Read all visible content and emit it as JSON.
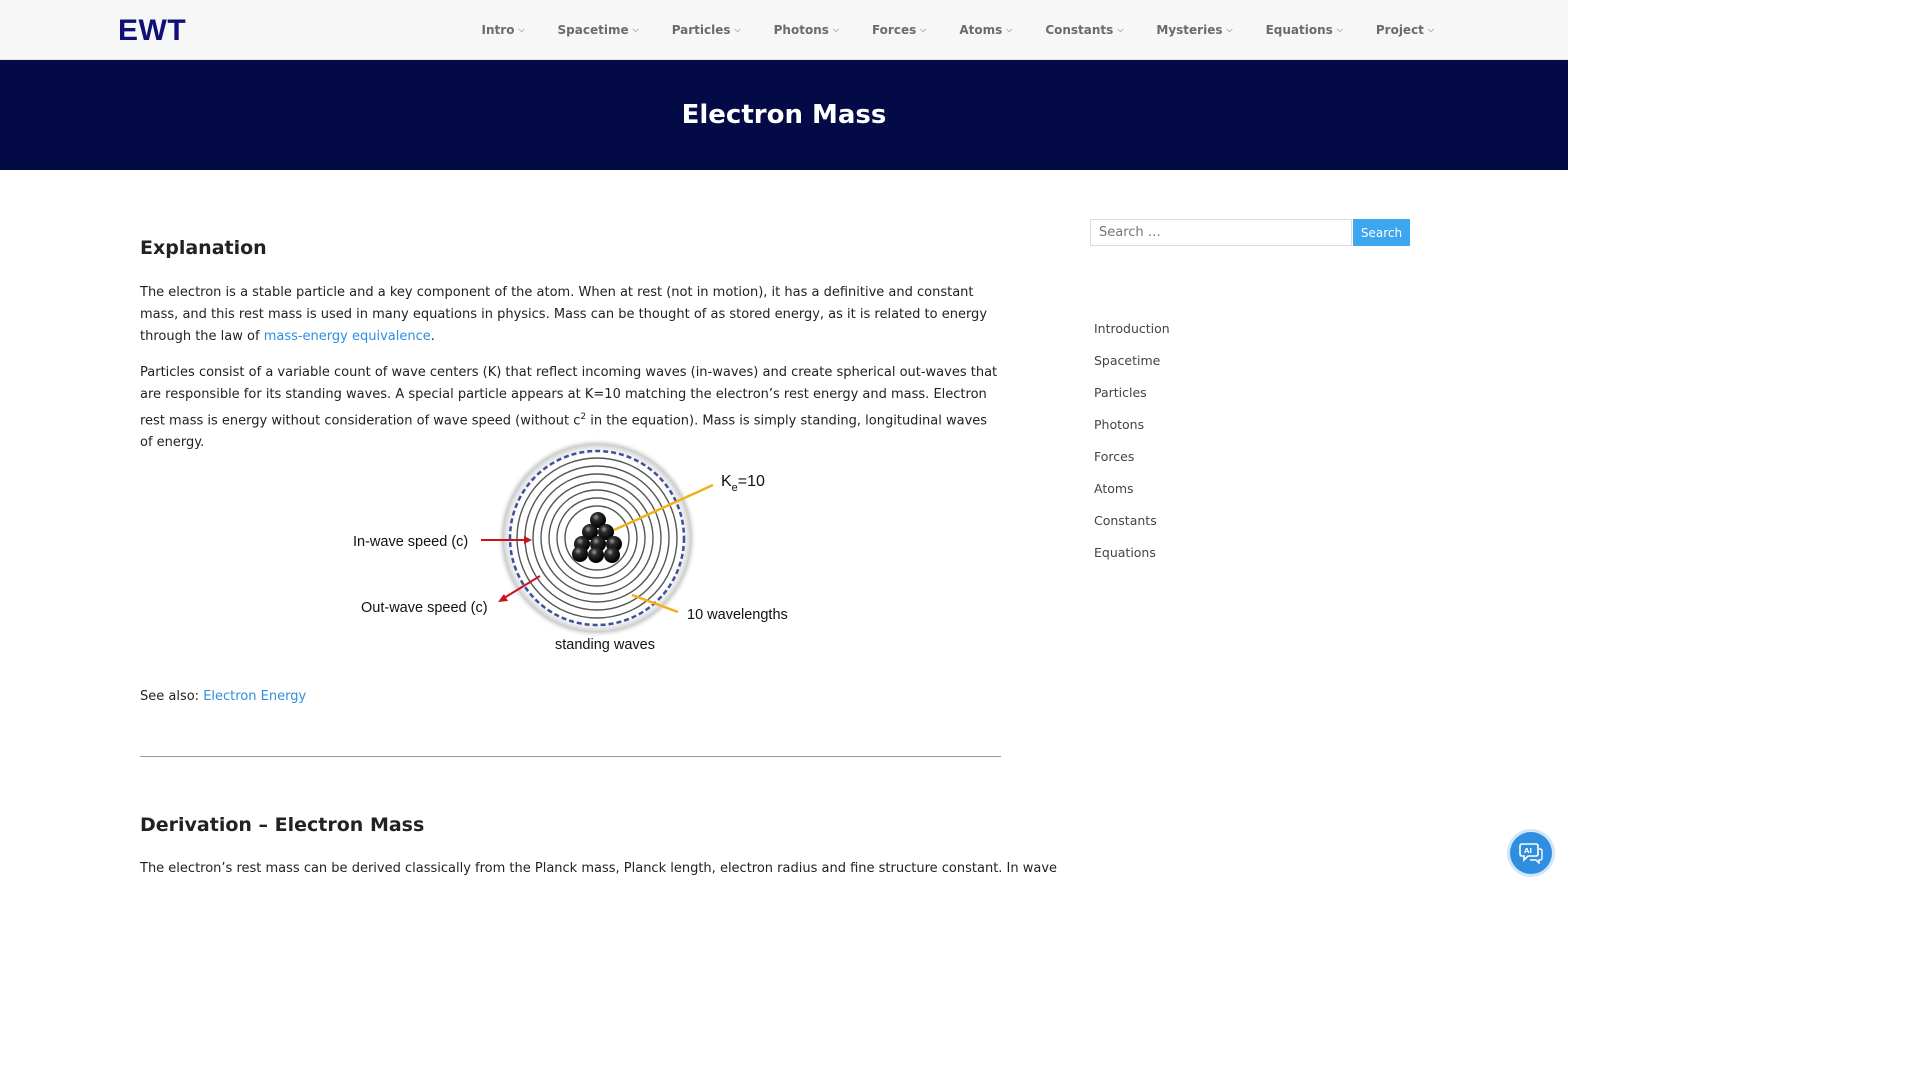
{
  "site": {
    "logo": "EWT"
  },
  "nav": {
    "items": [
      "Intro",
      "Spacetime",
      "Particles",
      "Photons",
      "Forces",
      "Atoms",
      "Constants",
      "Mysteries",
      "Equations",
      "Project"
    ]
  },
  "hero": {
    "title": "Electron Mass"
  },
  "content": {
    "explanation_heading": "Explanation",
    "p1_a": "The electron is a stable particle and a key component of the atom. When at rest (not in motion), it has a definitive and constant mass, and this rest mass is used in many equations in physics.  Mass can be thought of as stored energy, as it is related to energy through the law of ",
    "p1_link": "mass-energy equivalence",
    "p1_b": ".",
    "p2_a": "Particles consist of a variable count of wave centers (K) that reflect incoming waves (in-waves) and create spherical out-waves that are responsible for its standing waves.  A special particle appears at K=10 matching the electron’s rest energy and mass.  Electron rest mass is energy without consideration of wave speed (without c",
    "p2_sup": "2",
    "p2_b": " in the equation).  Mass is simply standing, longitudinal waves of energy.",
    "figure": {
      "ke_label_base": "K",
      "ke_label_sub": "e",
      "ke_label_value": "=10",
      "inwave_label": "In-wave speed (c)",
      "outwave_label": "Out-wave speed (c)",
      "wavelengths_label": "10 wavelengths",
      "caption": "standing waves",
      "colors": {
        "in_arrow": "#c8141c",
        "pointer": "#f2b11c",
        "outer_ring": "#3f4f9a"
      }
    },
    "see_also_label": "See also: ",
    "see_also_link": "Electron Energy",
    "derivation_heading": "Derivation – Electron Mass",
    "p3": "The electron’s rest mass can be derived classically from the Planck mass, Planck length, electron radius and fine structure constant.  In wave"
  },
  "sidebar": {
    "search_placeholder": "Search …",
    "search_button": "Search",
    "links": [
      "Introduction",
      "Spacetime",
      "Particles",
      "Photons",
      "Forces",
      "Atoms",
      "Constants",
      "Equations"
    ]
  },
  "chat": {
    "icon": "ai-chat-icon"
  }
}
